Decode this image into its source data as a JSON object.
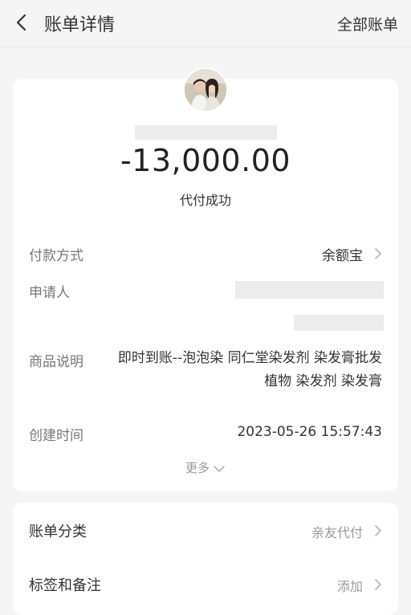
{
  "header": {
    "title": "账单详情",
    "right_link": "全部账单",
    "back_icon": "chevron-left-icon"
  },
  "summary": {
    "amount": "-13,000.00",
    "status": "代付成功"
  },
  "details": {
    "payment_method_label": "付款方式",
    "payment_method_value": "余额宝",
    "applicant_label": "申请人",
    "product_label": "商品说明",
    "product_value": "即时到账--泡泡染 同仁堂染发剂 染发膏批发植物 染发剂 染发膏",
    "created_label": "创建时间",
    "created_value": "2023-05-26 15:57:43",
    "more_label": "更多"
  },
  "extra": {
    "category_label": "账单分类",
    "category_value": "亲友代付",
    "tags_label": "标签和备注",
    "tags_value": "添加"
  },
  "colors": {
    "background": "#f5f5f5",
    "card": "#ffffff",
    "muted": "#999999",
    "label": "#777777"
  }
}
